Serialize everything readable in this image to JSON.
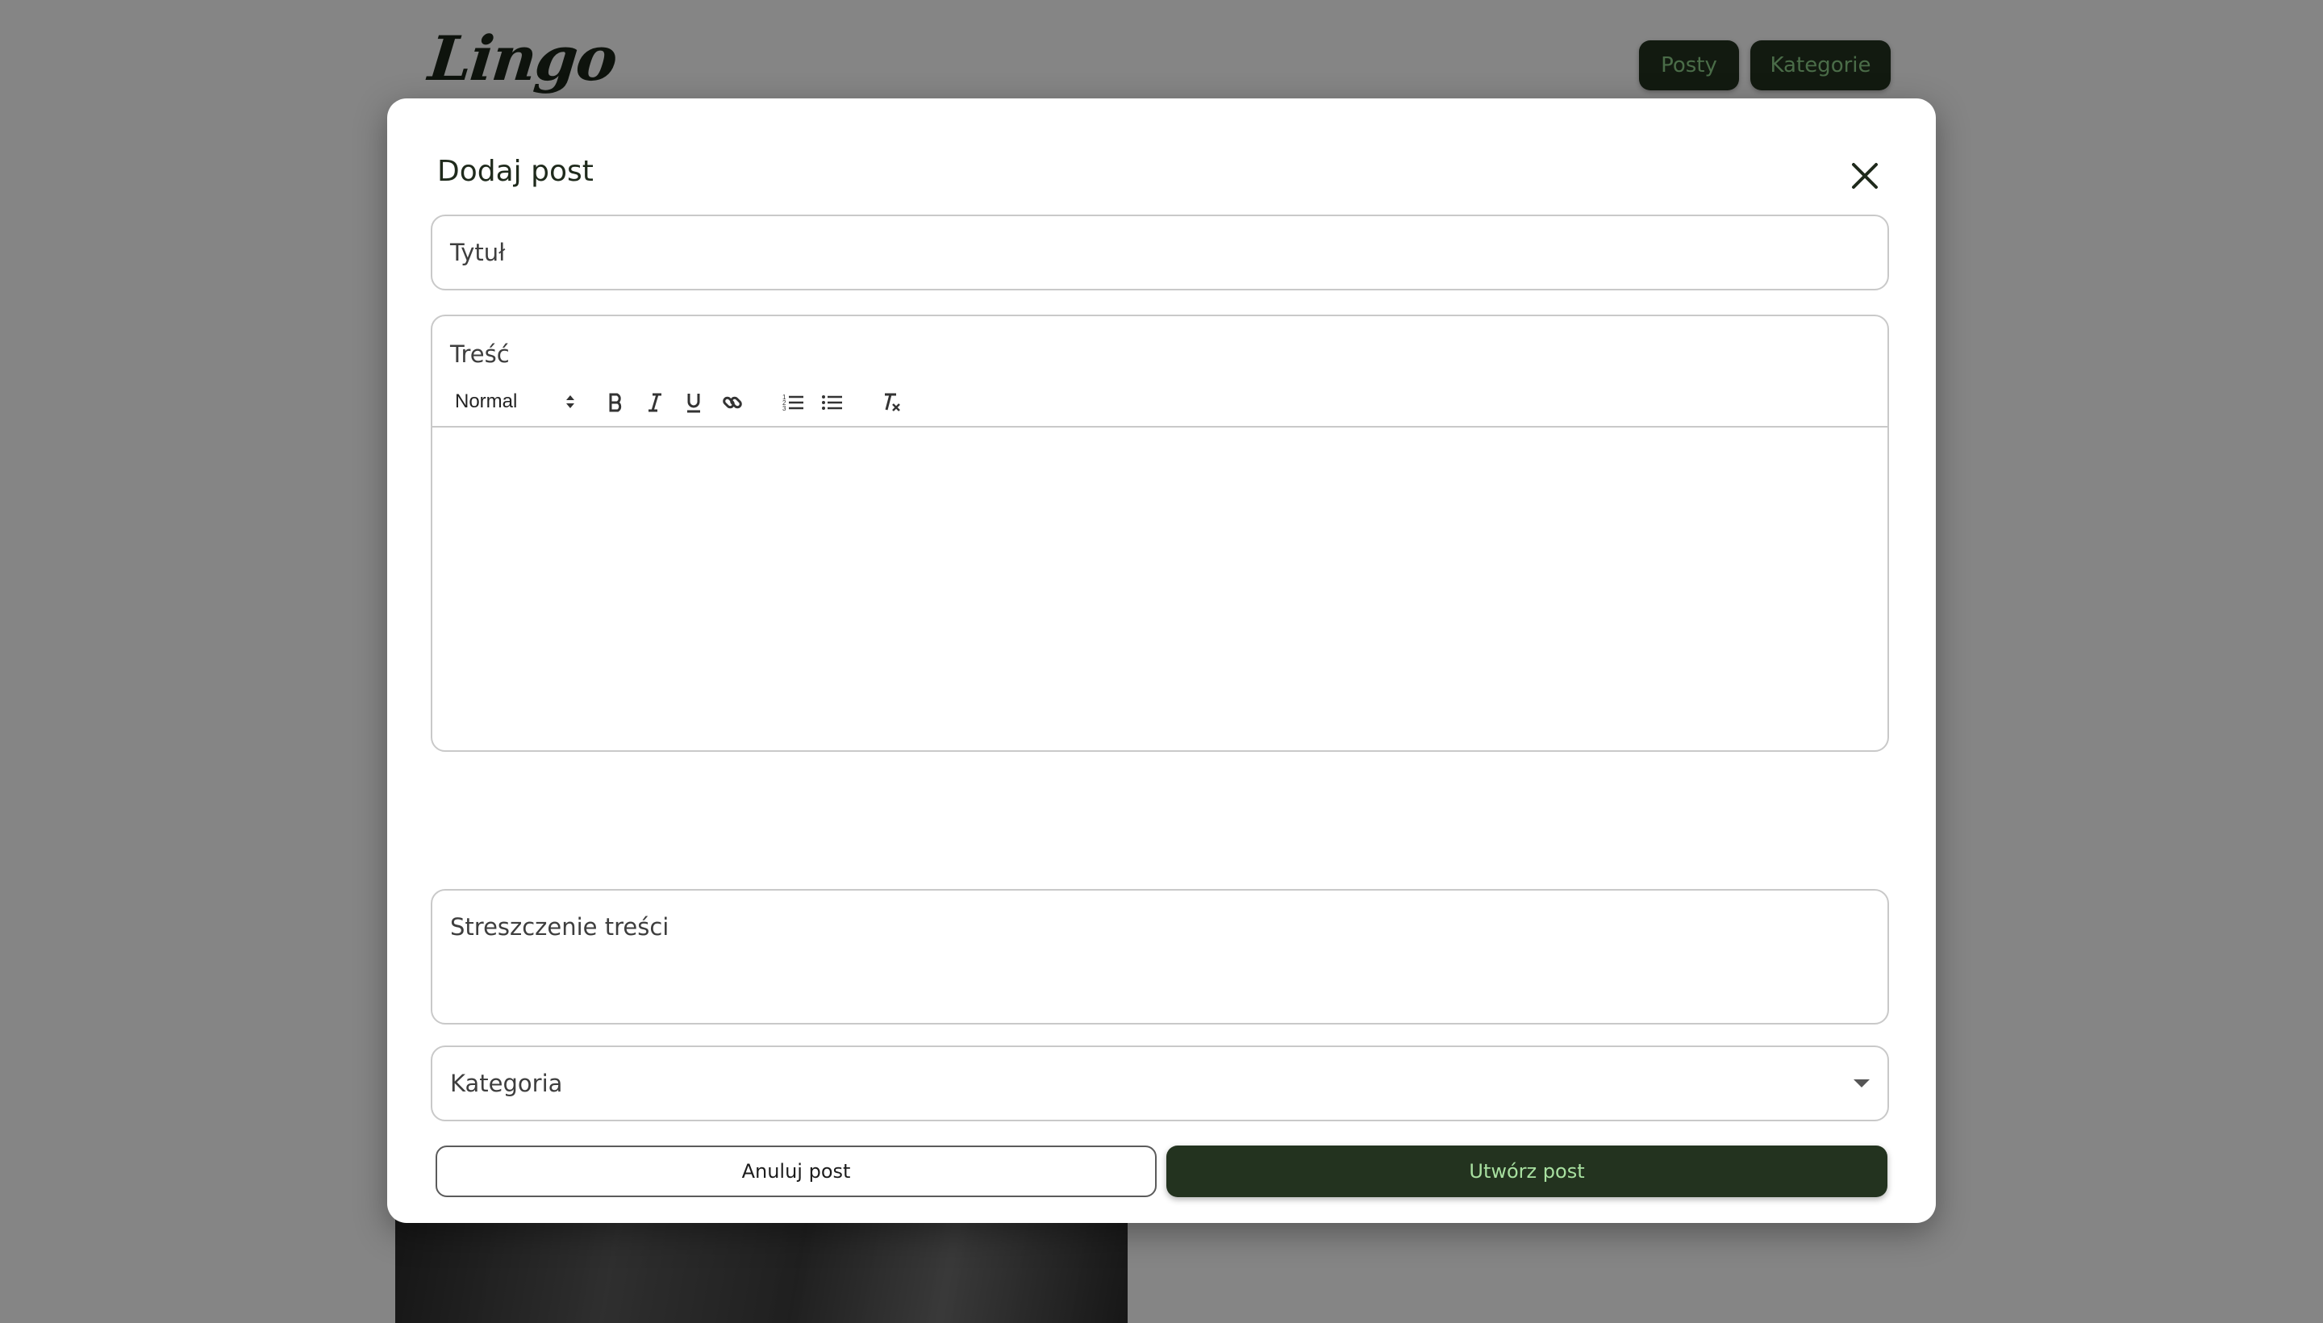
{
  "header": {
    "logo": "Lingo",
    "nav": [
      {
        "label": "Posty"
      },
      {
        "label": "Kategorie"
      }
    ]
  },
  "modal": {
    "title": "Dodaj post",
    "close_icon": "close-icon",
    "title_field": {
      "placeholder": "Tytuł"
    },
    "content_field": {
      "label": "Treść",
      "toolbar": {
        "format_value": "Normal",
        "buttons": [
          "bold-icon",
          "italic-icon",
          "underline-icon",
          "link-icon",
          "ordered-list-icon",
          "bullet-list-icon",
          "clear-format-icon"
        ]
      }
    },
    "summary_field": {
      "placeholder": "Streszczenie treści"
    },
    "category_field": {
      "placeholder": "Kategoria"
    },
    "cancel_label": "Anuluj post",
    "submit_label": "Utwórz post"
  },
  "colors": {
    "accent": "#23331f",
    "accent_text": "#a8e0a0",
    "overlay": "rgba(0,0,0,0.48)"
  }
}
